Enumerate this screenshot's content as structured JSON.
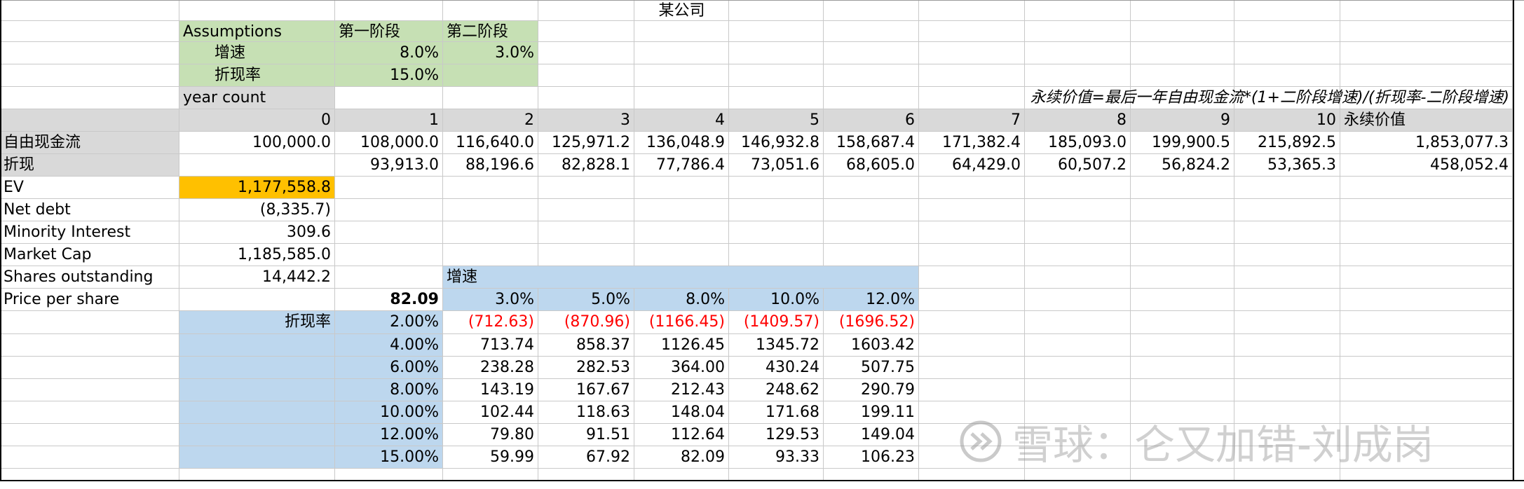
{
  "sheet": {
    "title": "某公司",
    "assumptions": {
      "header": "Assumptions",
      "stage1": "第一阶段",
      "stage2": "第二阶段",
      "growth_label": "增速",
      "growth_stage1": "8.0%",
      "growth_stage2": "3.0%",
      "discount_label": "折现率",
      "discount_rate": "15.0%"
    },
    "terminal_formula": "永续价值=最后一年自由现金流*(1+二阶段增速)/(折现率-二阶段增速)",
    "year_count_label": "year count",
    "years": [
      "0",
      "1",
      "2",
      "3",
      "4",
      "5",
      "6",
      "7",
      "8",
      "9",
      "10"
    ],
    "terminal_label": "永续价值",
    "fcf": {
      "label": "自由现金流",
      "values": [
        "100,000.0",
        "108,000.0",
        "116,640.0",
        "125,971.2",
        "136,048.9",
        "146,932.8",
        "158,687.4",
        "171,382.4",
        "185,093.0",
        "199,900.5",
        "215,892.5"
      ],
      "terminal": "1,853,077.3"
    },
    "discounted": {
      "label": "折现",
      "values": [
        "",
        "93,913.0",
        "88,196.6",
        "82,828.1",
        "77,786.4",
        "73,051.6",
        "68,605.0",
        "64,429.0",
        "60,507.2",
        "56,824.2",
        "53,365.3"
      ],
      "terminal": "458,052.4"
    },
    "valuation": [
      {
        "label": "EV",
        "value": "1,177,558.8"
      },
      {
        "label": "Net debt",
        "value": "(8,335.7)"
      },
      {
        "label": "Minority Interest",
        "value": "309.6"
      },
      {
        "label": "Market Cap",
        "value": "1,185,585.0"
      },
      {
        "label": "Shares outstanding",
        "value": "14,442.2"
      },
      {
        "label": "Price per share",
        "value": "82.09"
      }
    ],
    "sensitivity": {
      "growth_label": "增速",
      "discount_label": "折现率",
      "growth_rates": [
        "3.0%",
        "5.0%",
        "8.0%",
        "10.0%",
        "12.0%"
      ],
      "rows": [
        {
          "rate": "2.00%",
          "values": [
            "(712.63)",
            "(870.96)",
            "(1166.45)",
            "(1409.57)",
            "(1696.52)"
          ],
          "negative": true
        },
        {
          "rate": "4.00%",
          "values": [
            "713.74",
            "858.37",
            "1126.45",
            "1345.72",
            "1603.42"
          ],
          "negative": false
        },
        {
          "rate": "6.00%",
          "values": [
            "238.28",
            "282.53",
            "364.00",
            "430.24",
            "507.75"
          ],
          "negative": false
        },
        {
          "rate": "8.00%",
          "values": [
            "143.19",
            "167.67",
            "212.43",
            "248.62",
            "290.79"
          ],
          "negative": false
        },
        {
          "rate": "10.00%",
          "values": [
            "102.44",
            "118.63",
            "148.04",
            "171.68",
            "199.11"
          ],
          "negative": false
        },
        {
          "rate": "12.00%",
          "values": [
            "79.80",
            "91.51",
            "112.64",
            "129.53",
            "149.04"
          ],
          "negative": false
        },
        {
          "rate": "15.00%",
          "values": [
            "59.99",
            "67.92",
            "82.09",
            "93.33",
            "106.23"
          ],
          "negative": false
        }
      ]
    },
    "watermark": "雪球：仑又加错-刘成岗"
  }
}
